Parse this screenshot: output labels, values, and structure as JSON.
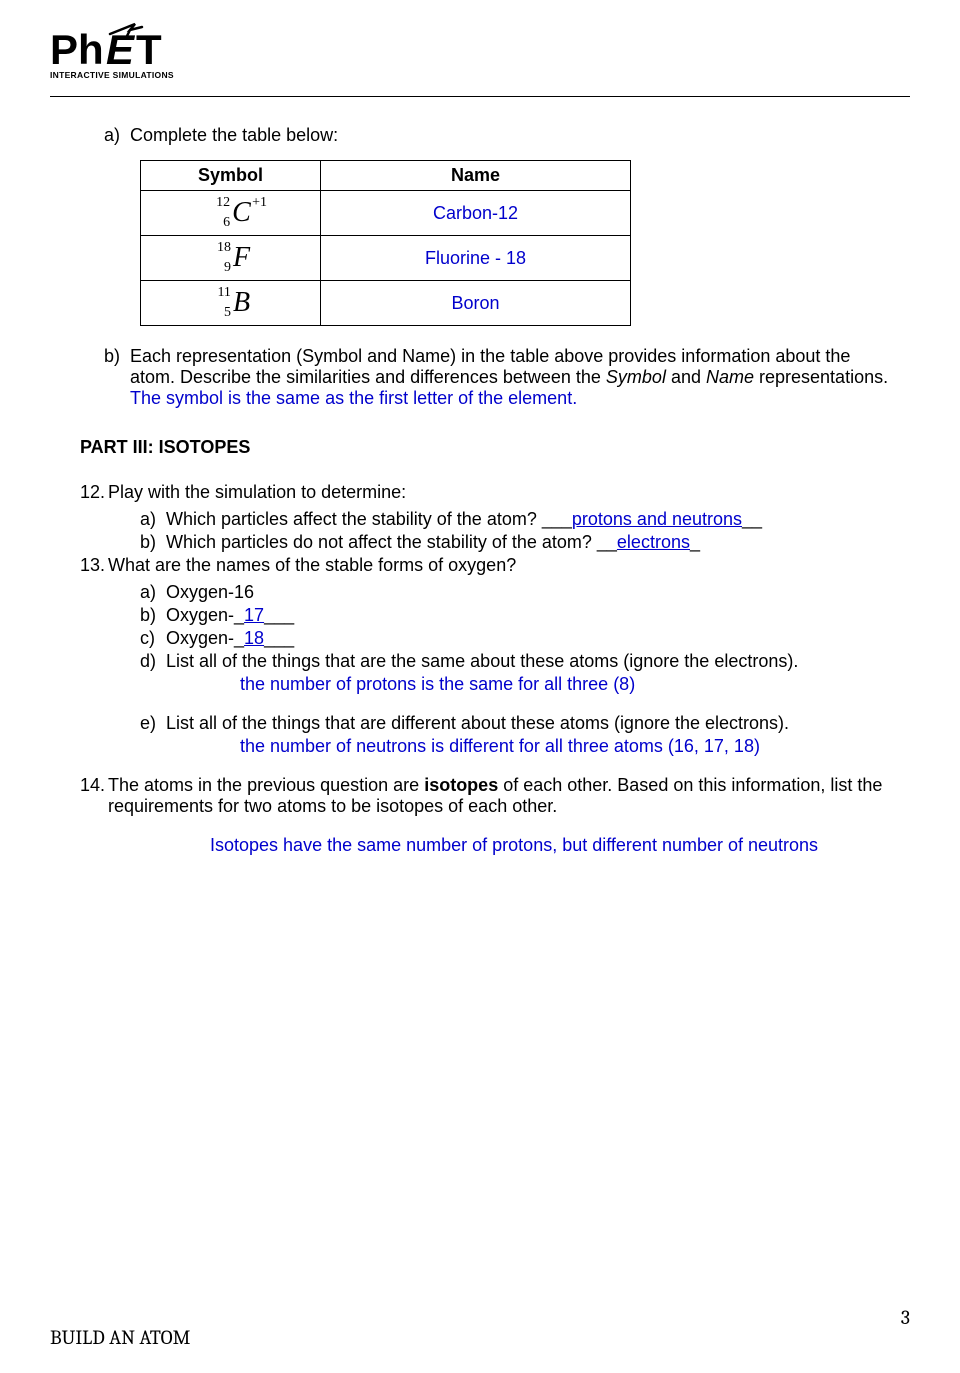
{
  "logo": {
    "main": "PhET",
    "sub": "INTERACTIVE SIMULATIONS"
  },
  "qa": {
    "prompt": "Complete the table below:",
    "label": "a)"
  },
  "table": {
    "headers": {
      "symbol": "Symbol",
      "name": "Name"
    },
    "rows": [
      {
        "letter": "C",
        "mass": "12",
        "atomic": "6",
        "charge": "+1",
        "name": "Carbon-12"
      },
      {
        "letter": "F",
        "mass": "18",
        "atomic": "9",
        "charge": "",
        "name": "Fluorine - 18"
      },
      {
        "letter": "B",
        "mass": "11",
        "atomic": "5",
        "charge": "",
        "name": "Boron"
      }
    ]
  },
  "qb": {
    "label": "b)",
    "line1": "Each representation (Symbol and Name) in the table above provides information about the atom. Describe the similarities and differences between the ",
    "i1": "Symbol",
    "line2": " and ",
    "i2": "Name",
    "line3": " representations.",
    "answer": "The symbol is the same as the first letter of the element."
  },
  "part3_head": "PART III: ISOTOPES",
  "q12": {
    "num": "12.",
    "text": "Play with the simulation to determine:",
    "a_label": "a)",
    "a_text": "Which particles affect the stability of the atom? ___",
    "a_ans": "protons and neutrons",
    "a_tail": "__",
    "b_label": "b)",
    "b_text": "Which particles do not affect the stability of the atom? __",
    "b_ans": "electrons",
    "b_tail": "_"
  },
  "q13": {
    "num": "13.",
    "text": "What are the names of the stable forms of oxygen?",
    "a_label": "a)",
    "a_text": "Oxygen-16",
    "b_label": "b)",
    "b_text_pre": "Oxygen-_",
    "b_ans": "17",
    "b_text_post": "___",
    "c_label": "c)",
    "c_text_pre": "Oxygen-_",
    "c_ans": "18",
    "c_text_post": "___",
    "d_label": "d)",
    "d_text": "List all of the things that are the same about these atoms (ignore the electrons).",
    "d_ans": "the number of protons is the same for all three (8)",
    "e_label": "e)",
    "e_text": "List all of the things that are different about these atoms (ignore the electrons).",
    "e_ans": "the number of neutrons is different for all three atoms (16, 17, 18)"
  },
  "q14": {
    "num": "14.",
    "text_pre": "The atoms in the previous question are ",
    "bold": "isotopes",
    "text_post": " of each other.  Based on this information, list the requirements for two atoms to be isotopes of each other.",
    "ans": "Isotopes have the same number of protons, but different number of neutrons"
  },
  "footer": {
    "title": "BUILD AN ATOM",
    "page": "3"
  }
}
